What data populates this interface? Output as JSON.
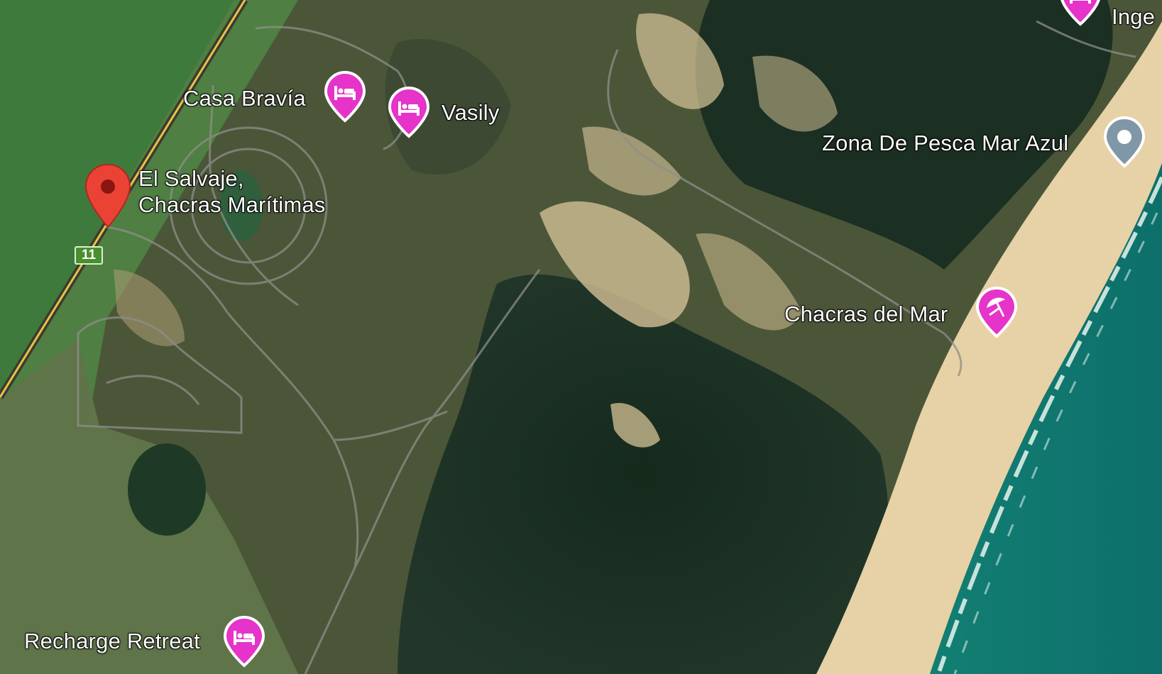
{
  "map": {
    "view": "satellite",
    "colors": {
      "poi_pink": "#e633c9",
      "pin_red": "#ea4335",
      "pin_gray": "#7f97a6",
      "ocean": "#0f7c74",
      "sand": "#e6d2a6",
      "shield_green": "#4a8f2f"
    },
    "route_shield": {
      "number": "11"
    },
    "places": {
      "casa_bravia": {
        "name": "Casa Bravía",
        "icon": "bed-icon"
      },
      "vasily": {
        "name": "Vasily",
        "icon": "bed-icon"
      },
      "ingenio": {
        "name": "Inge",
        "icon": "bed-icon"
      },
      "zona_pesca": {
        "name": "Zona De Pesca Mar Azul",
        "icon": "dot-pin-icon"
      },
      "el_salvaje": {
        "line1": "El Salvaje,",
        "line2": "Chacras Marítimas",
        "icon": "red-pin-icon"
      },
      "chacras_del_mar": {
        "name": "Chacras del Mar",
        "icon": "beach-umbrella-icon"
      },
      "recharge_retreat": {
        "name": "Recharge Retreat",
        "icon": "bed-icon"
      }
    }
  }
}
